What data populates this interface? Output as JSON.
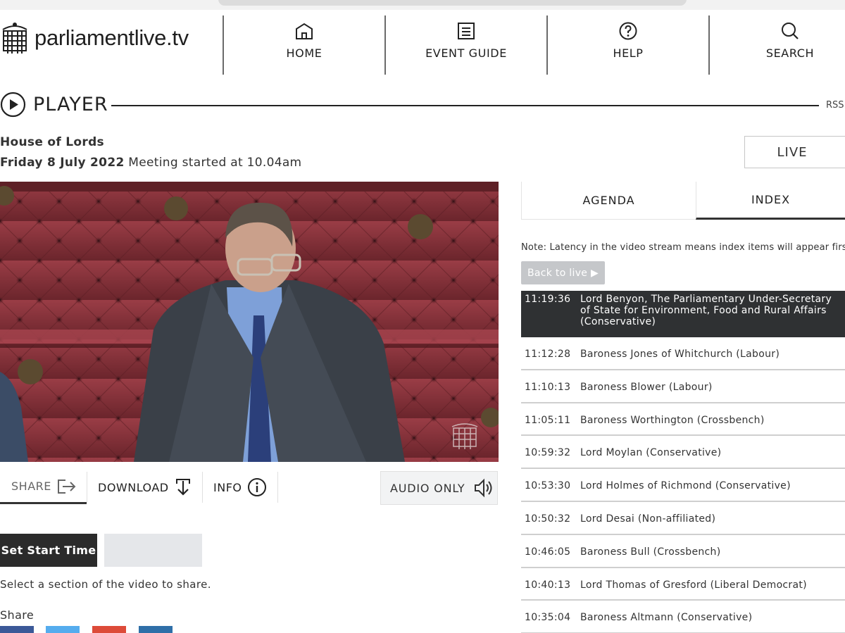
{
  "site": {
    "logo_text": "parliamentlive.tv"
  },
  "nav": [
    {
      "label": "HOME",
      "icon": "home-icon"
    },
    {
      "label": "EVENT GUIDE",
      "icon": "document-icon"
    },
    {
      "label": "HELP",
      "icon": "help-icon"
    },
    {
      "label": "SEARCH",
      "icon": "search-icon"
    }
  ],
  "player": {
    "title": "PLAYER",
    "rss": "RSS",
    "house": "House of Lords",
    "date": "Friday 8 July 2022",
    "meeting": "Meeting started at 10.04am",
    "live_label": "LIVE"
  },
  "controls": {
    "share": "SHARE",
    "download": "DOWNLOAD",
    "info": "INFO",
    "audio_only": "AUDIO ONLY"
  },
  "share_section": {
    "set_start_label": "Set Start Time",
    "start_value": "",
    "hint": "Select a section of the video to share.",
    "share_label": "Share"
  },
  "tabs": {
    "agenda": "AGENDA",
    "index": "INDEX"
  },
  "index_note": "Note: Latency in the video stream means index items will appear first.",
  "back_to_live": "Back to live ▶",
  "index_items": [
    {
      "time": "11:19:36",
      "text": "Lord Benyon, The Parliamentary Under-Secretary of State for Environment, Food and Rural Affairs (Conservative)"
    },
    {
      "time": "11:12:28",
      "text": "Baroness Jones of Whitchurch (Labour)"
    },
    {
      "time": "11:10:13",
      "text": "Baroness Blower (Labour)"
    },
    {
      "time": "11:05:11",
      "text": "Baroness Worthington (Crossbench)"
    },
    {
      "time": "10:59:32",
      "text": "Lord Moylan (Conservative)"
    },
    {
      "time": "10:53:30",
      "text": "Lord Holmes of Richmond (Conservative)"
    },
    {
      "time": "10:50:32",
      "text": "Lord Desai (Non-affiliated)"
    },
    {
      "time": "10:46:05",
      "text": "Baroness Bull (Crossbench)"
    },
    {
      "time": "10:40:13",
      "text": "Lord Thomas of Gresford (Liberal Democrat)"
    },
    {
      "time": "10:35:04",
      "text": "Baroness Altmann (Conservative)"
    }
  ],
  "colors": {
    "active_row": "#2f3133",
    "set_start_bg": "#2b2b2b",
    "back_live_bg": "#c5c7ca",
    "facebook": "#3b5998",
    "twitter": "#55acee",
    "google": "#dd4b39",
    "linkedin": "#2f6fa8"
  }
}
